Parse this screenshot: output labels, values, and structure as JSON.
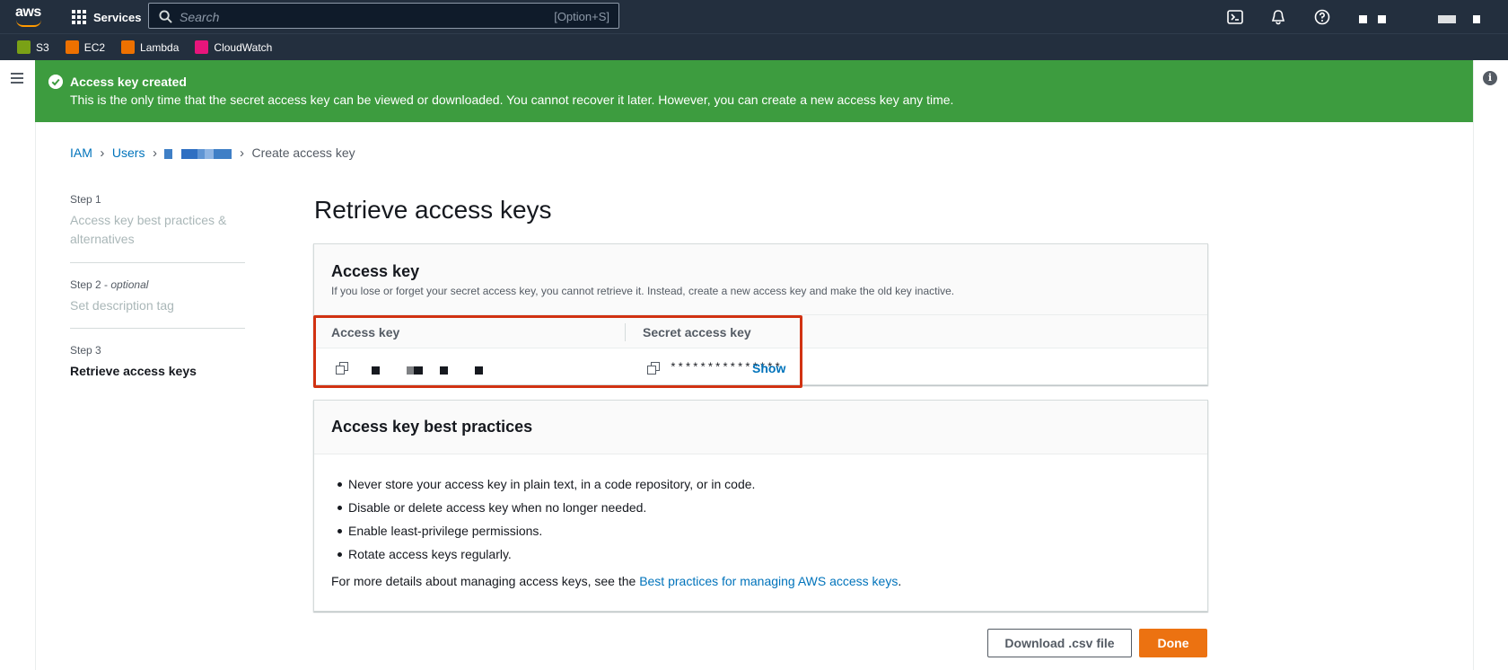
{
  "header": {
    "services_label": "Services",
    "search_placeholder": "Search",
    "search_shortcut": "[Option+S]"
  },
  "favorites": [
    {
      "label": "S3",
      "color": "#7aa116"
    },
    {
      "label": "EC2",
      "color": "#ed7100"
    },
    {
      "label": "Lambda",
      "color": "#ed7100"
    },
    {
      "label": "CloudWatch",
      "color": "#e7157b"
    }
  ],
  "flash": {
    "title": "Access key created",
    "message": "This is the only time that the secret access key can be viewed or downloaded. You cannot recover it later. However, you can create a new access key any time."
  },
  "breadcrumb": {
    "items": [
      "IAM",
      "Users"
    ],
    "current": "Create access key"
  },
  "wizard": {
    "steps": [
      {
        "number": "Step 1",
        "optional": "",
        "name": "Access key best practices & alternatives"
      },
      {
        "number": "Step 2",
        "optional": "optional",
        "name": "Set description tag"
      },
      {
        "number": "Step 3",
        "optional": "",
        "name": "Retrieve access keys"
      }
    ]
  },
  "page": {
    "title": "Retrieve access keys"
  },
  "access_key_panel": {
    "title": "Access key",
    "description": "If you lose or forget your secret access key, you cannot retrieve it. Instead, create a new access key and make the old key inactive.",
    "col_access_key": "Access key",
    "col_secret_key": "Secret access key",
    "secret_masked": "***************",
    "show_label": "Show"
  },
  "best_practices": {
    "title": "Access key best practices",
    "items": [
      "Never store your access key in plain text, in a code repository, or in code.",
      "Disable or delete access key when no longer needed.",
      "Enable least-privilege permissions.",
      "Rotate access keys regularly."
    ],
    "more_prefix": "For more details about managing access keys, see the",
    "more_link": "Best practices for managing AWS access keys",
    "more_suffix": "."
  },
  "actions": {
    "download_label": "Download .csv file",
    "done_label": "Done"
  },
  "colors": {
    "nav_bg": "#232f3e",
    "success": "#3d9c3f",
    "link": "#0073bb",
    "primary": "#ec7211",
    "highlight": "#d13212"
  }
}
